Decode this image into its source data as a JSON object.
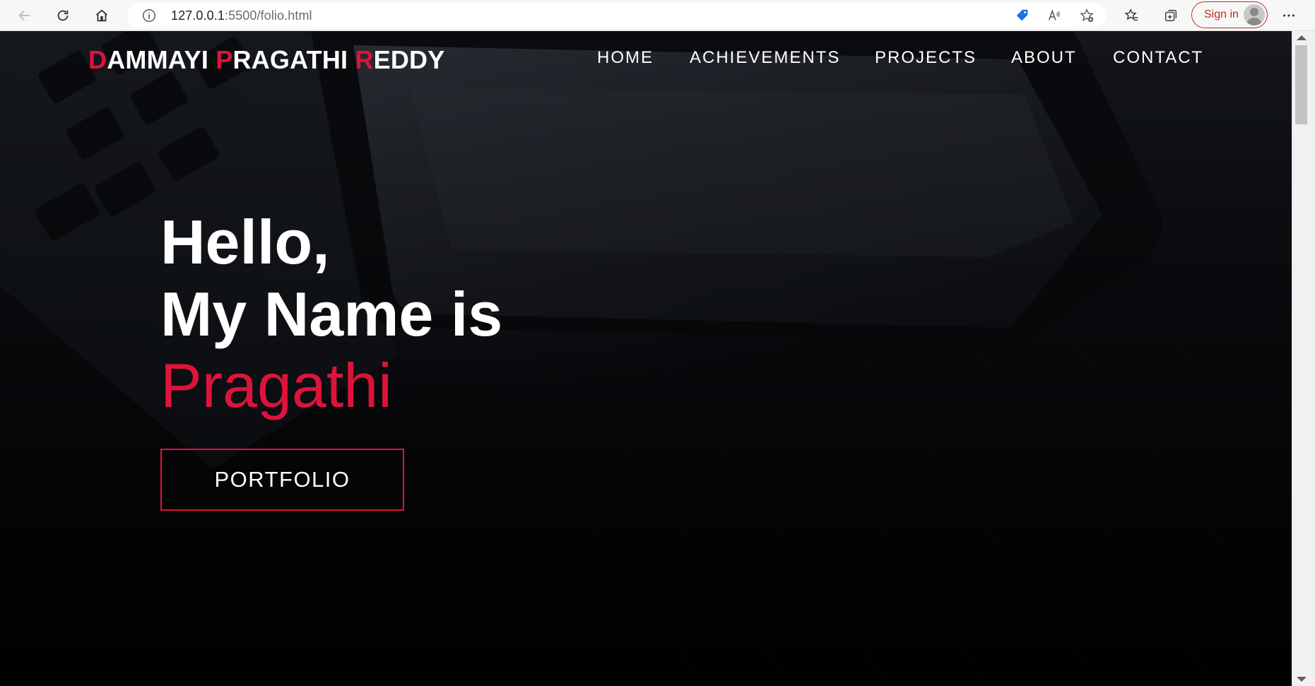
{
  "browser": {
    "url_host": "127.0.0.1",
    "url_rest": ":5500/folio.html",
    "sign_in_label": "Sign in",
    "icons": [
      "back-arrow-icon",
      "refresh-icon",
      "home-icon",
      "site-info-icon",
      "shopping-tag-icon",
      "read-aloud-icon",
      "add-favorite-icon",
      "favorites-icon",
      "collections-icon",
      "profile-avatar-icon",
      "more-menu-icon"
    ]
  },
  "header": {
    "logo_parts": [
      {
        "accent": "D",
        "rest": "AMMAYI "
      },
      {
        "accent": "P",
        "rest": "RAGATHI "
      },
      {
        "accent": "R",
        "rest": "EDDY"
      }
    ],
    "nav": [
      "HOME",
      "ACHIEVEMENTS",
      "PROJECTS",
      "ABOUT",
      "CONTACT"
    ]
  },
  "hero": {
    "line1": "Hello,",
    "line2": "My Name is",
    "name": "Pragathi",
    "button_label": "PORTFOLIO"
  },
  "colors": {
    "accent": "#dc143c",
    "text": "#ffffff",
    "background": "#0b0c10",
    "signin": "#c42b1c"
  }
}
